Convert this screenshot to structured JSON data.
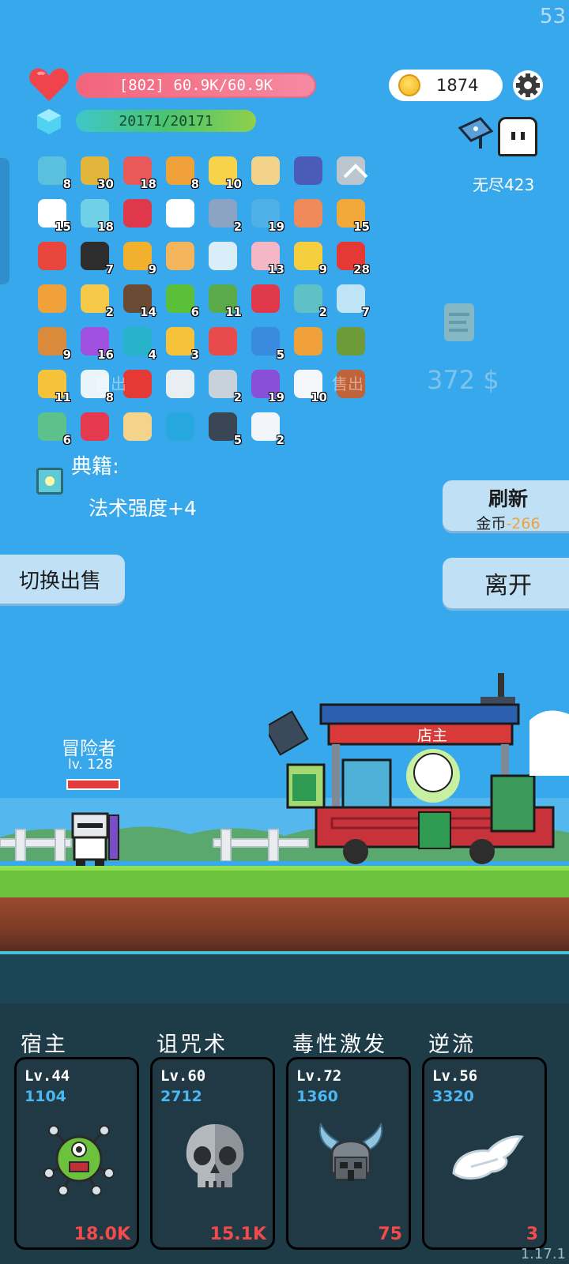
{
  "hud": {
    "fps": "53",
    "hp_text": "[802] 60.9K/60.9K",
    "mp_text": "20171/20171",
    "coins": "1874",
    "endless_label": "无尽423"
  },
  "inventory": {
    "items": [
      {
        "icon": "sword-icon",
        "count": "8",
        "color": "#5bc0de"
      },
      {
        "icon": "pineapple-icon",
        "count": "30",
        "color": "#e3b43a"
      },
      {
        "icon": "watermelon-icon",
        "count": "18",
        "color": "#e85a5a"
      },
      {
        "icon": "book-icon",
        "count": "8",
        "color": "#f0a13a"
      },
      {
        "icon": "bulb-icon",
        "count": "10",
        "color": "#f6d34a"
      },
      {
        "icon": "scroll-icon",
        "count": "",
        "color": "#f3d289"
      },
      {
        "icon": "wizard-hat-icon",
        "count": "",
        "color": "#4a5bb8"
      },
      {
        "icon": "dagger-icon",
        "count": "",
        "color": "#bcc6cf"
      },
      {
        "icon": "cloud-icon",
        "count": "15",
        "color": "#ffffff"
      },
      {
        "icon": "potion-icon",
        "count": "18",
        "color": "#6fd0e6"
      },
      {
        "icon": "ruby-icon",
        "count": "",
        "color": "#e0384b"
      },
      {
        "icon": "ghost-icon",
        "count": "",
        "color": "#ffffff"
      },
      {
        "icon": "shield-icon",
        "count": "2",
        "color": "#8ba4c4"
      },
      {
        "icon": "chat-icon",
        "count": "19",
        "color": "#4fb0e8"
      },
      {
        "icon": "crown-icon",
        "count": "",
        "color": "#f08a5a"
      },
      {
        "icon": "pineapple-icon",
        "count": "15",
        "color": "#f1a93a"
      },
      {
        "icon": "hearts-icon",
        "count": "",
        "color": "#e8453c"
      },
      {
        "icon": "cauldron-icon",
        "count": "7",
        "color": "#2d2d2d"
      },
      {
        "icon": "coins-icon",
        "count": "9",
        "color": "#f2b12c"
      },
      {
        "icon": "menu-icon",
        "count": "",
        "color": "#f4b55c"
      },
      {
        "icon": "lines-icon",
        "count": "",
        "color": "#d9eef8"
      },
      {
        "icon": "icecream-icon",
        "count": "13",
        "color": "#f5b6c6"
      },
      {
        "icon": "cheese-icon",
        "count": "9",
        "color": "#f6cf3f"
      },
      {
        "icon": "mushroom-icon",
        "count": "28",
        "color": "#e53935"
      },
      {
        "icon": "torch-icon",
        "count": "",
        "color": "#f0a13a"
      },
      {
        "icon": "note-icon",
        "count": "2",
        "color": "#f7c948"
      },
      {
        "icon": "coconut-icon",
        "count": "14",
        "color": "#6b4a33"
      },
      {
        "icon": "lime-icon",
        "count": "6",
        "color": "#5cbf3a"
      },
      {
        "icon": "cash-icon",
        "count": "11",
        "color": "#5aa94a"
      },
      {
        "icon": "badge-icon",
        "count": "",
        "color": "#e0384b"
      },
      {
        "icon": "disc-icon",
        "count": "2",
        "color": "#5fc1c7"
      },
      {
        "icon": "sparkle-icon",
        "count": "7",
        "color": "#bfe4f6"
      },
      {
        "icon": "bow-icon",
        "count": "9",
        "color": "#d98a3a"
      },
      {
        "icon": "orb-icon",
        "count": "16",
        "color": "#a050e0"
      },
      {
        "icon": "target-icon",
        "count": "4",
        "color": "#27b3c9"
      },
      {
        "icon": "wand-icon",
        "count": "3",
        "color": "#f6c23a"
      },
      {
        "icon": "percent-icon",
        "count": "",
        "color": "#e84b4b"
      },
      {
        "icon": "star-card-icon",
        "count": "5",
        "color": "#3a8be0"
      },
      {
        "icon": "briefcase-icon",
        "count": "",
        "color": "#f0a13a"
      },
      {
        "icon": "grenade-icon",
        "count": "",
        "color": "#6e9b3a"
      },
      {
        "icon": "sunflower-icon",
        "count": "11",
        "color": "#f6c23a"
      },
      {
        "icon": "lightbulb-icon",
        "count": "8",
        "color": "#e9f4fb"
      },
      {
        "icon": "apple-icon",
        "count": "",
        "color": "#e53935"
      },
      {
        "icon": "clipboard-icon",
        "count": "",
        "color": "#e9eef2"
      },
      {
        "icon": "compass-icon",
        "count": "2",
        "color": "#c8d2da"
      },
      {
        "icon": "chest-icon",
        "count": "19",
        "color": "#8a4fd8"
      },
      {
        "icon": "mail-icon",
        "count": "10",
        "color": "#f4f7fa"
      },
      {
        "icon": "flag-cake-icon",
        "count": "",
        "color": "#c0623a"
      },
      {
        "icon": "slime-icon",
        "count": "6",
        "color": "#5cc18a"
      },
      {
        "icon": "strawberry-icon",
        "count": "",
        "color": "#e53950"
      },
      {
        "icon": "map-icon",
        "count": "",
        "color": "#f4d48a"
      },
      {
        "icon": "gem-icon",
        "count": "",
        "color": "#27a9e0"
      },
      {
        "icon": "skull-book-icon",
        "count": "5",
        "color": "#3a4654"
      },
      {
        "icon": "pill-icon",
        "count": "2",
        "color": "#f2f6fa"
      }
    ]
  },
  "tome": {
    "label": "典籍:",
    "bonus": "法术强度+4"
  },
  "shop_overlay": {
    "faint_left": "售出",
    "faint_right": "售出",
    "price": "372 $"
  },
  "buttons": {
    "refresh_title": "刷新",
    "refresh_currency": "金币",
    "refresh_cost": "-266",
    "leave": "离开",
    "switch_sell": "切换出售"
  },
  "scene": {
    "adventurer_name": "冒险者",
    "adventurer_level": "lv. 128",
    "shopkeeper": "店主"
  },
  "skills": [
    {
      "title": "宿主",
      "level": "Lv.44",
      "value": "1104",
      "damage": "18.0K",
      "icon": "virus-monster-icon"
    },
    {
      "title": "诅咒术",
      "level": "Lv.60",
      "value": "2712",
      "damage": "15.1K",
      "icon": "skull-icon"
    },
    {
      "title": "毒性激发",
      "level": "Lv.72",
      "value": "1360",
      "damage": "75",
      "icon": "viking-helmet-icon"
    },
    {
      "title": "逆流",
      "level": "Lv.56",
      "value": "3320",
      "damage": "3",
      "icon": "wing-icon"
    }
  ],
  "version": "1.17.1",
  "colors": {
    "sky": "#38a8ec",
    "hp": "#f3647b",
    "mp": "#4bc36e",
    "damage": "#f24b4b",
    "value": "#4bb7f0"
  }
}
